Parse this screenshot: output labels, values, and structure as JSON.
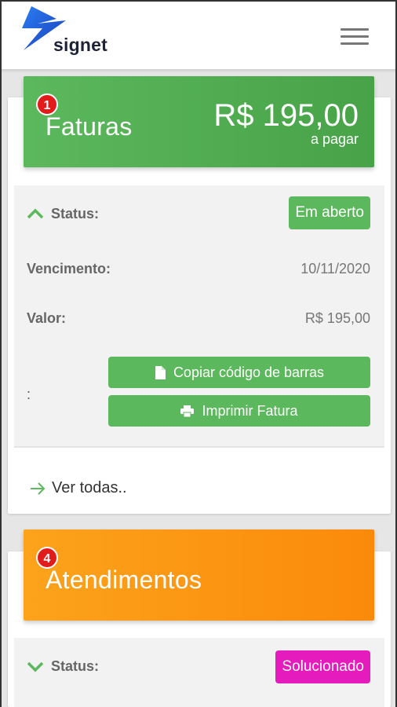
{
  "header": {
    "brand": "signet",
    "logo_icon": "lightning-bolt-icon",
    "menu_icon": "hamburger-menu-icon"
  },
  "invoices": {
    "badge_count": "1",
    "title": "Faturas",
    "amount": "R$ 195,00",
    "amount_caption": "a pagar",
    "status_label": "Status:",
    "status_value": "Em aberto",
    "due_label": "Vencimento:",
    "due_value": "10/11/2020",
    "value_label": "Valor:",
    "value_value": "R$ 195,00",
    "actions_label": ":",
    "copy_barcode_button": "Copiar código de barras",
    "print_invoice_button": "Imprimir Fatura",
    "see_all_link": "Ver todas.."
  },
  "tickets": {
    "badge_count": "4",
    "title": "Atendimentos",
    "status_label": "Status:",
    "status_value": "Solucionado"
  },
  "colors": {
    "green": "#5cb85c",
    "orange": "#fb8a0a",
    "magenta": "#e61bbd",
    "badge_red": "#e21b1b",
    "logo_blue": "#1e63e6"
  }
}
